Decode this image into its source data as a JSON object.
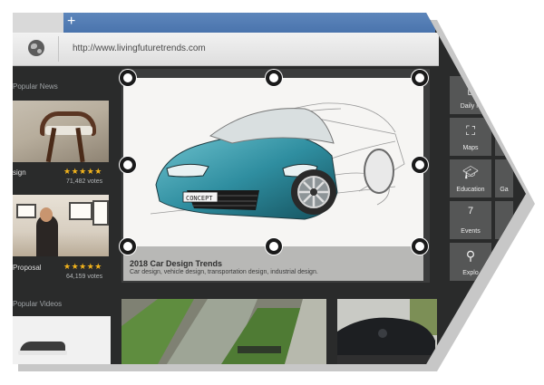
{
  "browser": {
    "new_tab_icon": "+",
    "url": "http://www.livingfuturetrends.com"
  },
  "left": {
    "popular_news": "Popular News",
    "news": [
      {
        "title": "sign",
        "stars": "★★★★★",
        "votes": "71,482 votes"
      },
      {
        "title": "Proposal",
        "stars": "★★★★★",
        "votes": "64,159 votes"
      }
    ],
    "popular_videos": "Popular Videos"
  },
  "featured": {
    "image_text": "CONCEPT",
    "title": "2018 Car Design Trends",
    "subtitle": "Car design, vehicle design, transportation design, industrial design."
  },
  "tiles": [
    {
      "label": "Daily N",
      "icon": "calendar-icon"
    },
    {
      "label": "Maps",
      "icon": "map-icon"
    },
    {
      "label": "Education",
      "icon": "graduation-cap-icon"
    },
    {
      "label": "Events",
      "icon": "calendar-icon",
      "glyph": "7"
    },
    {
      "label": "Explo",
      "icon": "hiker-icon"
    },
    {
      "label": "Ga",
      "icon": "game-icon"
    }
  ],
  "colors": {
    "accent_tab": "#4a74ad",
    "stars": "#f2b31c",
    "background_dark": "#2a2b2b",
    "tile": "#555656"
  }
}
